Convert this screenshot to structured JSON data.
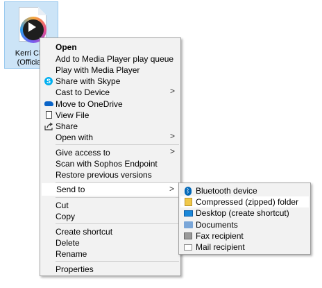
{
  "file": {
    "name_line1": "Kerri Cha",
    "name_line2": "(Official)"
  },
  "main_menu": {
    "open": "Open",
    "add_queue": "Add to Media Player play queue",
    "play": "Play with Media Player",
    "skype": "Share with Skype",
    "cast": "Cast to Device",
    "onedrive": "Move to OneDrive",
    "view_file": "View File",
    "share": "Share",
    "open_with": "Open with",
    "give_access": "Give access to",
    "scan": "Scan with Sophos Endpoint",
    "restore": "Restore previous versions",
    "send_to": "Send to",
    "cut": "Cut",
    "copy": "Copy",
    "create_shortcut": "Create shortcut",
    "delete": "Delete",
    "rename": "Rename",
    "properties": "Properties",
    "arrow": ">"
  },
  "send_to_menu": {
    "bluetooth": "Bluetooth device",
    "zip": "Compressed (zipped) folder",
    "desktop": "Desktop (create shortcut)",
    "documents": "Documents",
    "fax": "Fax recipient",
    "mail": "Mail recipient"
  },
  "colors": {
    "selection_tile": "#cce4f7",
    "menu_bg": "#f2f2f2",
    "highlight": "#ffffff"
  }
}
